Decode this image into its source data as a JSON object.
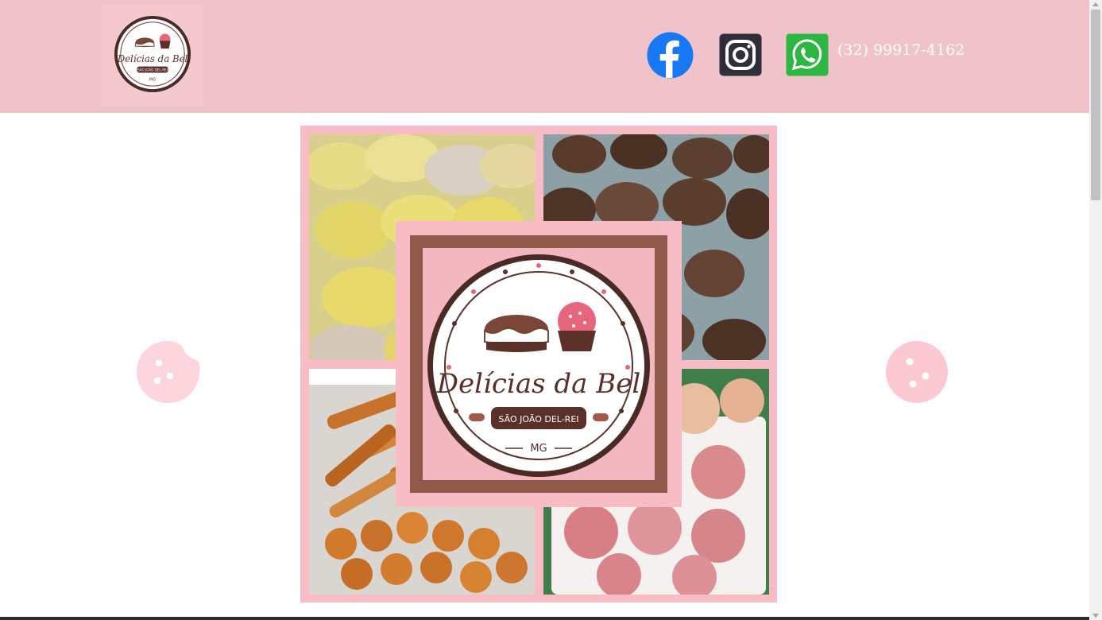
{
  "header": {
    "logo": {
      "brand_name": "Delícias da Bel",
      "city": "SÃO JOÃO DEL-REI",
      "state": "MG"
    },
    "social": [
      {
        "icon": "facebook-icon",
        "color": "#1877f2"
      },
      {
        "icon": "instagram-icon",
        "color": "#2f2f3a"
      },
      {
        "icon": "whatsapp-icon",
        "color": "#2bb741"
      }
    ],
    "phone": "(32) 99917-4162"
  },
  "hero": {
    "center_logo": {
      "brand_name": "Delícias da Bel",
      "city": "SÃO JOÃO DEL-REI",
      "state": "MG"
    },
    "photos": [
      "pastel-photo",
      "kibe-photo",
      "fried-snacks-photo",
      "mini-pizza-photo"
    ]
  },
  "colors": {
    "header_bg": "#f0c2ca",
    "frame_pink": "#f7bcc4",
    "brown": "#5a3028",
    "cookie_pink": "#fcd6dc"
  }
}
